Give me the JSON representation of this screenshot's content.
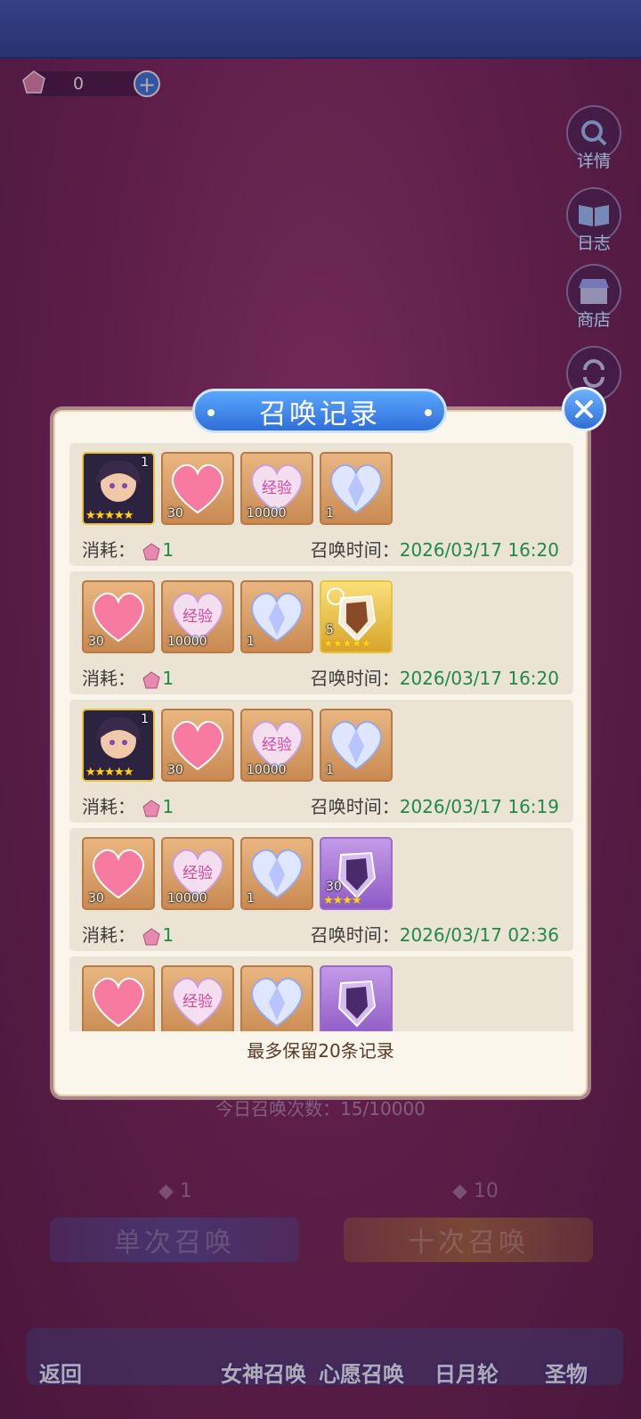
{
  "currency": {
    "value": "0"
  },
  "side_buttons": {
    "details": "详情",
    "log": "日志",
    "shop": "商店",
    "exchange": "换"
  },
  "dialog": {
    "title": "召唤记录",
    "footer": "最多保留20条记录",
    "cost_label": "消耗：",
    "time_label": "召唤时间：",
    "records": [
      {
        "cost": "1",
        "time": "2026/03/17 16:20",
        "items": [
          {
            "icon": "character-portrait-icon",
            "count": "1",
            "stars": "★★★★★",
            "frame": "gold"
          },
          {
            "icon": "pink-heart-icon",
            "count": "30",
            "frame": "bronze"
          },
          {
            "icon": "exp-crystal-heart-icon",
            "count": "10000",
            "frame": "bronze"
          },
          {
            "icon": "diamond-heart-icon",
            "count": "1",
            "frame": "bronze"
          }
        ]
      },
      {
        "cost": "1",
        "time": "2026/03/17 16:20",
        "items": [
          {
            "icon": "pink-heart-icon",
            "count": "30",
            "frame": "bronze"
          },
          {
            "icon": "exp-crystal-heart-icon",
            "count": "10000",
            "frame": "bronze"
          },
          {
            "icon": "diamond-heart-icon",
            "count": "1",
            "frame": "bronze"
          },
          {
            "icon": "relic-shard-icon",
            "count": "5",
            "stars": "★★★★★",
            "frame": "gold"
          }
        ]
      },
      {
        "cost": "1",
        "time": "2026/03/17 16:19",
        "items": [
          {
            "icon": "character-portrait-icon",
            "count": "1",
            "stars": "★★★★★",
            "frame": "gold"
          },
          {
            "icon": "pink-heart-icon",
            "count": "30",
            "frame": "bronze"
          },
          {
            "icon": "exp-crystal-heart-icon",
            "count": "10000",
            "frame": "bronze"
          },
          {
            "icon": "diamond-heart-icon",
            "count": "1",
            "frame": "bronze"
          }
        ]
      },
      {
        "cost": "1",
        "time": "2026/03/17 02:36",
        "items": [
          {
            "icon": "pink-heart-icon",
            "count": "30",
            "frame": "bronze"
          },
          {
            "icon": "exp-crystal-heart-icon",
            "count": "10000",
            "frame": "bronze"
          },
          {
            "icon": "diamond-heart-icon",
            "count": "1",
            "frame": "bronze"
          },
          {
            "icon": "purple-relic-shard-icon",
            "count": "30",
            "stars": "★★★★",
            "frame": "purple"
          }
        ]
      },
      {
        "cost": "",
        "time": "",
        "items": [
          {
            "icon": "pink-heart-icon",
            "count": "",
            "frame": "bronze"
          },
          {
            "icon": "exp-crystal-heart-icon",
            "count": "",
            "frame": "bronze"
          },
          {
            "icon": "diamond-heart-icon",
            "count": "",
            "frame": "bronze"
          },
          {
            "icon": "purple-relic-shard-icon",
            "count": "",
            "frame": "purple"
          }
        ]
      }
    ]
  },
  "daily_count": "今日召唤次数：15/10000",
  "summon": {
    "single_label": "单次召唤",
    "single_cost": "1",
    "ten_label": "十次召唤",
    "ten_cost": "10"
  },
  "nav": {
    "back": "返回",
    "goddess": "女神召唤",
    "wish": "心愿召唤",
    "sunmoon": "日月轮",
    "relic": "圣物"
  },
  "colors": {
    "accent_blue": "#2f6fd8",
    "time_green": "#1f8a4a",
    "dialog_bg": "#fbf6ec"
  }
}
